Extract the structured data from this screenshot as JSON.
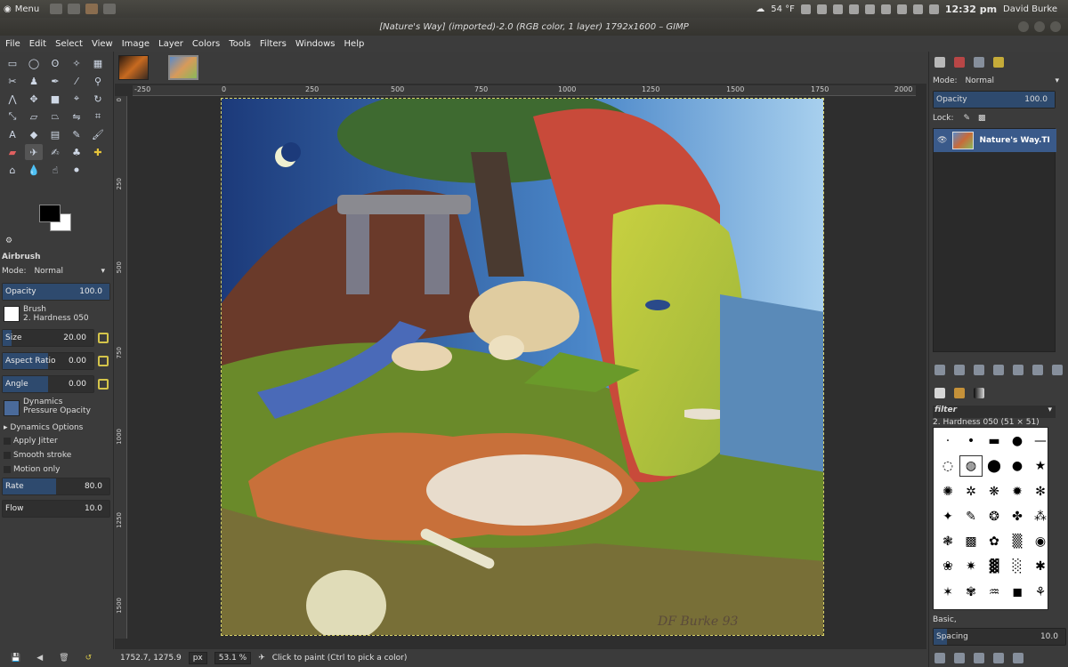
{
  "topbar": {
    "menu_label": "Menu",
    "temperature": "54 °F",
    "clock": "12:32 pm",
    "user": "David Burke"
  },
  "window": {
    "title": "[Nature's Way] (imported)-2.0 (RGB color, 1 layer) 1792x1600 – GIMP"
  },
  "menubar": [
    "File",
    "Edit",
    "Select",
    "View",
    "Image",
    "Layer",
    "Colors",
    "Tools",
    "Filters",
    "Windows",
    "Help"
  ],
  "tool_options": {
    "tool_name": "Airbrush",
    "mode_label": "Mode:",
    "mode_value": "Normal",
    "opacity": {
      "label": "Opacity",
      "value": "100.0",
      "fraction": 1.0
    },
    "brush_label": "Brush",
    "brush_value": "2. Hardness 050",
    "size": {
      "label": "Size",
      "value": "20.00",
      "fraction": 0.1
    },
    "aspect": {
      "label": "Aspect Ratio",
      "value": "0.00",
      "fraction": 0.5
    },
    "angle": {
      "label": "Angle",
      "value": "0.00",
      "fraction": 0.5
    },
    "dynamics_label": "Dynamics",
    "dynamics_value": "Pressure Opacity",
    "dynamics_options": "Dynamics Options",
    "apply_jitter": "Apply Jitter",
    "smooth_stroke": "Smooth stroke",
    "motion_only": "Motion only",
    "rate": {
      "label": "Rate",
      "value": "80.0",
      "fraction": 0.5
    },
    "flow": {
      "label": "Flow",
      "value": "10.0",
      "fraction": 0.0
    }
  },
  "ruler_h": [
    "-250",
    "0",
    "250",
    "500",
    "750",
    "1000",
    "1250",
    "1500",
    "1750",
    "2000"
  ],
  "ruler_v": [
    "0",
    "250",
    "500",
    "750",
    "1000",
    "1250",
    "1500"
  ],
  "status": {
    "coords": "1752.7, 1275.9",
    "unit": "px",
    "zoom": "53.1 %",
    "message": "Click to paint (Ctrl to pick a color)"
  },
  "layers": {
    "mode_label": "Mode:",
    "mode_value": "Normal",
    "opacity_label": "Opacity",
    "opacity_value": "100.0",
    "lock_label": "Lock:",
    "layer_name": "Nature's Way.TI"
  },
  "brushes": {
    "filter": "filter",
    "selected": "2. Hardness 050 (51 × 51)",
    "tag": "Basic,",
    "spacing_label": "Spacing",
    "spacing_value": "10.0"
  },
  "painting": {
    "signature": "DF Burke 93"
  }
}
